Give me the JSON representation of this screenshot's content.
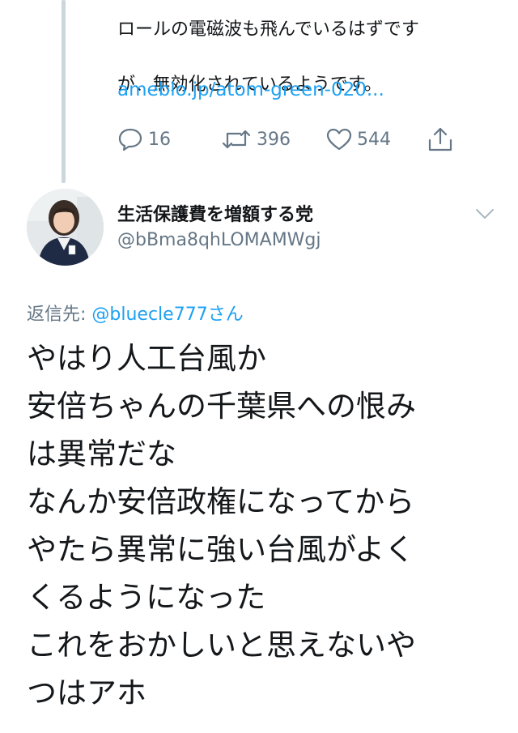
{
  "previous_tweet": {
    "text_lines": [
      "ロールの電磁波も飛んでいるはずです",
      "が、無効化されているようです。"
    ],
    "link": "ameblo.jp/atom-green-020...",
    "actions": {
      "reply_count": "16",
      "retweet_count": "396",
      "like_count": "544"
    }
  },
  "author": {
    "name": "生活保護費を増額する党",
    "handle": "@bBma8qhLOMAMWgj"
  },
  "reply_to": {
    "label": "返信先: ",
    "mention": "@bluecle777",
    "suffix": "さん"
  },
  "tweet_lines": [
    "やはり人工台風か",
    "安倍ちゃんの千葉県への恨み",
    "は異常だな",
    "なんか安倍政権になってから",
    "やたら異常に強い台風がよく",
    "くるようになった",
    "これをおかしいと思えないや",
    "つはアホ"
  ],
  "colors": {
    "link": "#1da1f2",
    "muted": "#657786",
    "text": "#14171a",
    "thread_line": "#ccd6dd"
  },
  "icons": [
    "reply-icon",
    "retweet-icon",
    "like-icon",
    "share-icon",
    "chevron-down-icon"
  ]
}
